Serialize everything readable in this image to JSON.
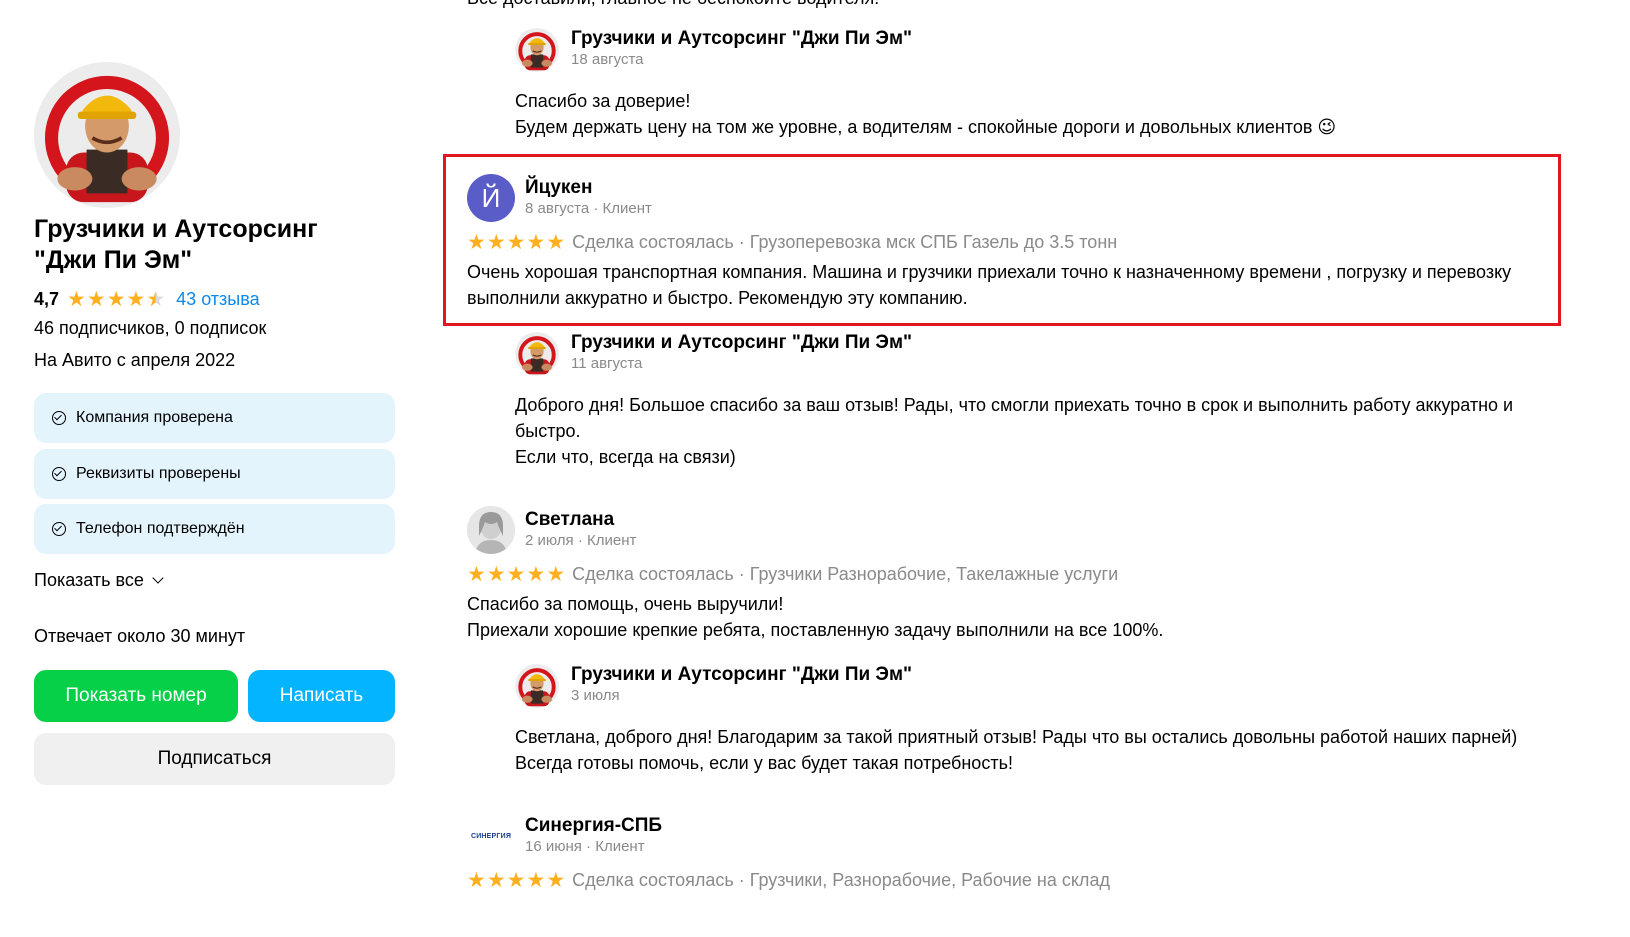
{
  "sidebar": {
    "company_name_line1": "Грузчики и Аутсорсинг",
    "company_name_line2": "\"Джи Пи Эм\"",
    "rating": "4,7",
    "rating_stars": 4.5,
    "reviews_link": "43 отзыва",
    "subscribers": "46 подписчиков, 0 подписок",
    "since": "На Авито с апреля 2022",
    "badges": [
      "Компания проверена",
      "Реквизиты проверены",
      "Телефон подтверждён"
    ],
    "show_all": "Показать все",
    "responds": "Отвечает около 30 минут",
    "btn_phone": "Показать номер",
    "btn_write": "Написать",
    "btn_subscribe": "Подписаться",
    "colors": {
      "green": "#05d047",
      "blue": "#04b4ff",
      "badge_bg": "#e3f4fd",
      "star": "#ffb021",
      "link": "#0a8aef"
    }
  },
  "feed": {
    "cutoff_text": "Все доставили, главное не беспокойте водителя!",
    "reply1": {
      "name": "Грузчики и Аутсорсинг \"Джи Пи Эм\"",
      "date": "18 августа",
      "line1": "Спасибо за доверие!",
      "line2": "Будем держать цену на том же уровне, а водителям - спокойные дороги и довольных клиентов 😉"
    },
    "review1": {
      "initial": "Й",
      "name": "Йцукен",
      "meta": "8 августа · Клиент",
      "stars": 5,
      "deal": "Сделка состоялась · Грузоперевозка мск СПБ Газель до 3.5 тонн",
      "line1": "Очень хорошая транспортная компания. Машина и грузчики приехали точно к назначенному времени , погрузку и перевозку",
      "line2": "выполнили аккуратно и быстро. Рекомендую эту компанию."
    },
    "reply2": {
      "name": "Грузчики и Аутсорсинг \"Джи Пи Эм\"",
      "date": "11 августа",
      "line1": "Доброго дня! Большое спасибо за ваш отзыв! Рады, что смогли приехать точно в срок и выполнить работу аккуратно и",
      "line2": "быстро.",
      "line3": "Если что, всегда на связи)"
    },
    "review2": {
      "name": "Светлана",
      "meta": "2 июля · Клиент",
      "stars": 5,
      "deal": "Сделка состоялась · Грузчики Разнорабочие, Такелажные услуги",
      "line1": "Спасибо за помощь, очень выручили!",
      "line2": "Приехали хорошие крепкие ребята, поставленную задачу выполнили на все 100%."
    },
    "reply3": {
      "name": "Грузчики и Аутсорсинг \"Джи Пи Эм\"",
      "date": "3 июля",
      "line1": "Светлана, доброго дня! Благодарим за такой приятный отзыв! Рады что вы остались довольны работой наших парней)",
      "line2": "Всегда готовы помочь, если у вас будет такая потребность!"
    },
    "review3": {
      "logo_text": "СИНЕРГИЯ",
      "name": "Синергия-СПБ",
      "meta": "16 июня · Клиент",
      "stars": 5,
      "deal": "Сделка состоялась · Грузчики, Разнорабочие, Рабочие на склад"
    }
  }
}
